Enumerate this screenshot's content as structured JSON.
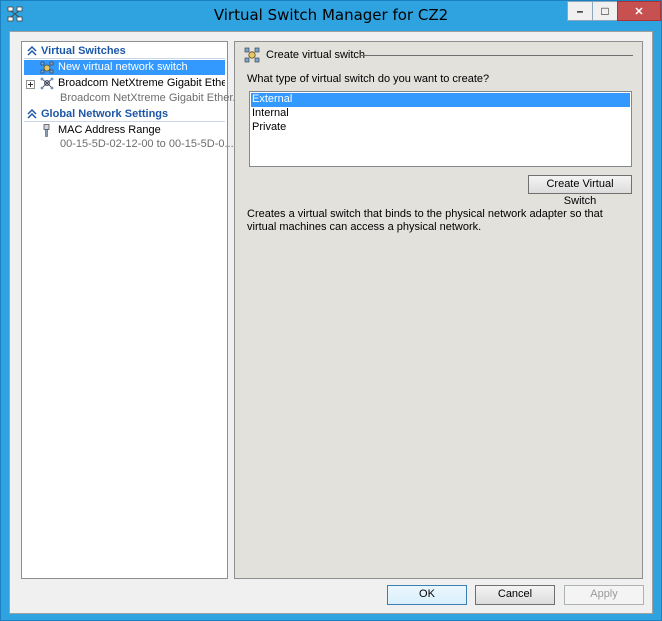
{
  "window": {
    "title": "Virtual Switch Manager for CZ2"
  },
  "caption": {
    "minimize": "–",
    "maximize": "□",
    "close": "✕"
  },
  "sidebar": {
    "sections": [
      {
        "title": "Virtual Switches",
        "items": [
          {
            "label": "New virtual network switch",
            "icon": "new-switch-icon"
          },
          {
            "label": "Broadcom NetXtreme Gigabit Ether...",
            "sub": "Broadcom NetXtreme Gigabit Ether...",
            "icon": "network-switch-icon"
          }
        ]
      },
      {
        "title": "Global Network Settings",
        "items": [
          {
            "label": "MAC Address Range",
            "sub": "00-15-5D-02-12-00 to 00-15-5D-0...",
            "icon": "mac-address-icon"
          }
        ]
      }
    ]
  },
  "main": {
    "header": "Create virtual switch",
    "question": "What type of virtual switch do you want to create?",
    "switch_types": [
      "External",
      "Internal",
      "Private"
    ],
    "selected_type": "External",
    "create_button": "Create Virtual Switch",
    "description": "Creates a virtual switch that binds to the physical network adapter so that virtual machines can access a physical network."
  },
  "footer": {
    "ok": "OK",
    "cancel": "Cancel",
    "apply": "Apply"
  },
  "colors": {
    "titlebar": "#2fa3e0",
    "selection": "#3399ff",
    "section_header": "#1c57a8",
    "close_button": "#c75050"
  }
}
